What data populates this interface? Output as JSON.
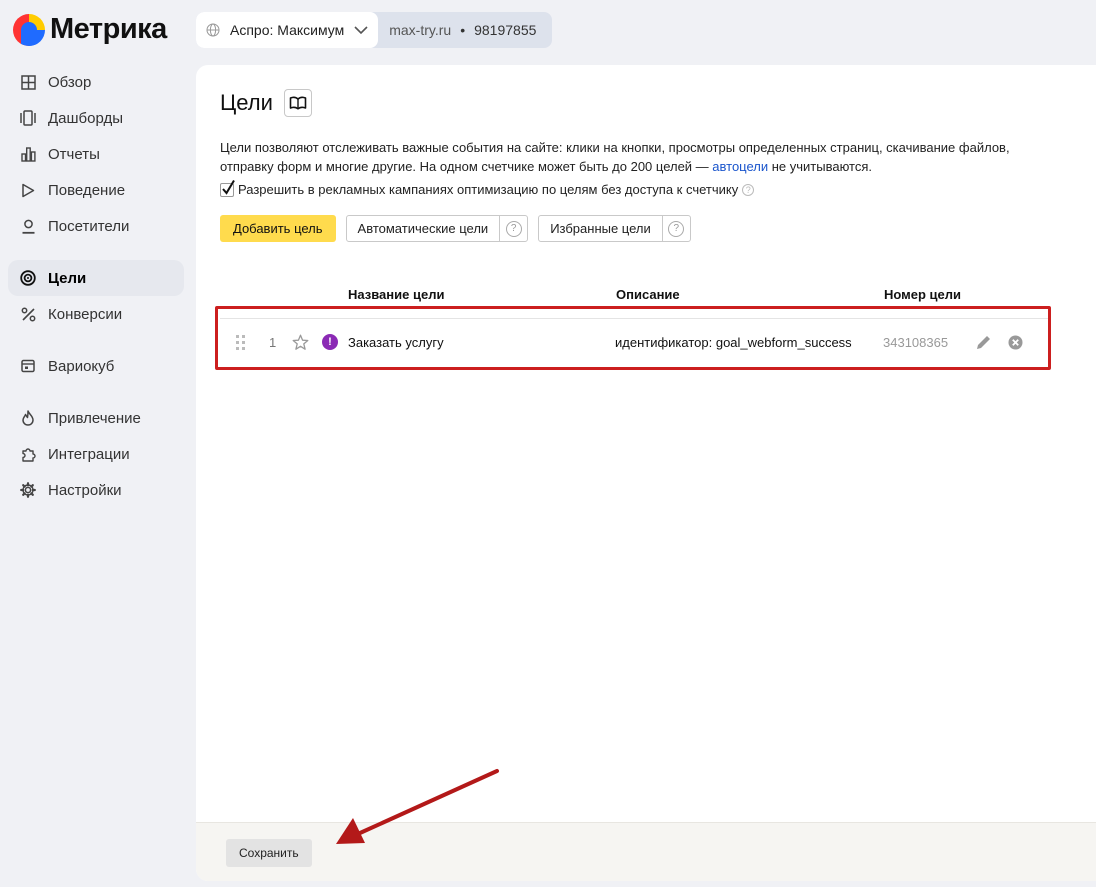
{
  "app": {
    "name": "Метрика"
  },
  "counter": {
    "name": "Аспро: Максимум",
    "site": "max-try.ru",
    "separator": "•",
    "id": "98197855"
  },
  "sidebar": {
    "items": [
      {
        "label": "Обзор",
        "icon": "grid-icon"
      },
      {
        "label": "Дашборды",
        "icon": "dashboard-icon"
      },
      {
        "label": "Отчеты",
        "icon": "bar-chart-icon"
      },
      {
        "label": "Поведение",
        "icon": "play-icon"
      },
      {
        "label": "Посетители",
        "icon": "user-icon"
      },
      {
        "label": "Цели",
        "icon": "target-icon",
        "active": true
      },
      {
        "label": "Конверсии",
        "icon": "percent-icon"
      },
      {
        "label": "Вариокуб",
        "icon": "calendar-icon"
      },
      {
        "label": "Привлечение",
        "icon": "flame-icon"
      },
      {
        "label": "Интеграции",
        "icon": "puzzle-icon"
      },
      {
        "label": "Настройки",
        "icon": "gear-icon"
      }
    ]
  },
  "page": {
    "title": "Цели",
    "description_part1": "Цели позволяют отслеживать важные события на сайте: клики на кнопки, просмотры определенных страниц, скачивание файлов, отправку форм и многие другие. На одном счетчике может быть до 200 целей — ",
    "description_link": "автоцели",
    "description_part2": " не учитываются.",
    "allow_label": "Разрешить в рекламных кампаниях оптимизацию по целям без доступа к счетчику",
    "allow_checked": true,
    "add_goal_button": "Добавить цель",
    "auto_goals_button": "Автоматические цели",
    "favorite_goals_button": "Избранные цели",
    "help_glyph": "?"
  },
  "table": {
    "headers": {
      "name": "Название цели",
      "description": "Описание",
      "id": "Номер цели"
    },
    "rows": [
      {
        "index": "1",
        "name": "Заказать услугу",
        "description": "идентификатор: goal_webform_success",
        "goal_id": "343108365",
        "warning_glyph": "!"
      }
    ]
  },
  "footer": {
    "save_button": "Сохранить"
  },
  "colors": {
    "accent_yellow": "#ffdb4d",
    "highlight_red": "#cc1f1f",
    "link_blue": "#1a55cc",
    "warning_purple": "#8b2ab5"
  }
}
